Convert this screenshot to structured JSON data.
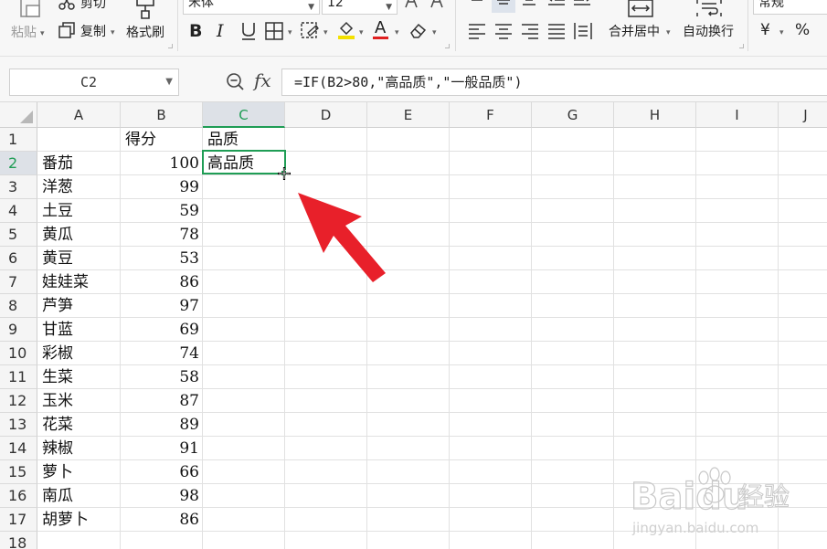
{
  "ribbon": {
    "paste_label": "粘贴",
    "cut_label": "剪切",
    "copy_label": "复制",
    "format_painter_label": "格式刷",
    "font_name": "宋体",
    "font_size": "12",
    "merge_center_label": "合并居中",
    "wrap_text_label": "自动换行",
    "number_format": "常规",
    "currency_symbol": "¥",
    "percent_symbol": "%",
    "bold": "B",
    "italic": "I",
    "underline": "U",
    "font_color_letter": "A",
    "font_color": "#e02020",
    "fill_color": "#f3e000"
  },
  "formula_bar": {
    "name_box": "C2",
    "fx_label": "fx",
    "formula": "=IF(B2>80,\"高品质\",\"一般品质\")"
  },
  "sheet": {
    "accent_color": "#1f9d55",
    "selected_cell": "C2",
    "columns": [
      "A",
      "B",
      "C",
      "D",
      "E",
      "F",
      "G",
      "H",
      "I",
      "J"
    ],
    "rows": [
      "1",
      "2",
      "3",
      "4",
      "5",
      "6",
      "7",
      "8",
      "9",
      "10",
      "11",
      "12",
      "13",
      "14",
      "15",
      "16",
      "17",
      "18"
    ],
    "headers": {
      "b": "得分",
      "c": "品质"
    },
    "data": [
      {
        "name": "番茄",
        "score": "100",
        "quality": "高品质"
      },
      {
        "name": "洋葱",
        "score": "99",
        "quality": ""
      },
      {
        "name": "土豆",
        "score": "59",
        "quality": ""
      },
      {
        "name": "黄瓜",
        "score": "78",
        "quality": ""
      },
      {
        "name": "黄豆",
        "score": "53",
        "quality": ""
      },
      {
        "name": "娃娃菜",
        "score": "86",
        "quality": ""
      },
      {
        "name": "芦笋",
        "score": "97",
        "quality": ""
      },
      {
        "name": "甘蓝",
        "score": "69",
        "quality": ""
      },
      {
        "name": "彩椒",
        "score": "74",
        "quality": ""
      },
      {
        "name": "生菜",
        "score": "58",
        "quality": ""
      },
      {
        "name": "玉米",
        "score": "87",
        "quality": ""
      },
      {
        "name": "花菜",
        "score": "89",
        "quality": ""
      },
      {
        "name": "辣椒",
        "score": "91",
        "quality": ""
      },
      {
        "name": "萝卜",
        "score": "66",
        "quality": ""
      },
      {
        "name": "南瓜",
        "score": "98",
        "quality": ""
      },
      {
        "name": "胡萝卜",
        "score": "86",
        "quality": ""
      }
    ]
  },
  "annotation": {
    "arrow_color": "#e8202a"
  },
  "watermark": {
    "line1": "经验",
    "line2": "jingyan.baidu.com"
  }
}
